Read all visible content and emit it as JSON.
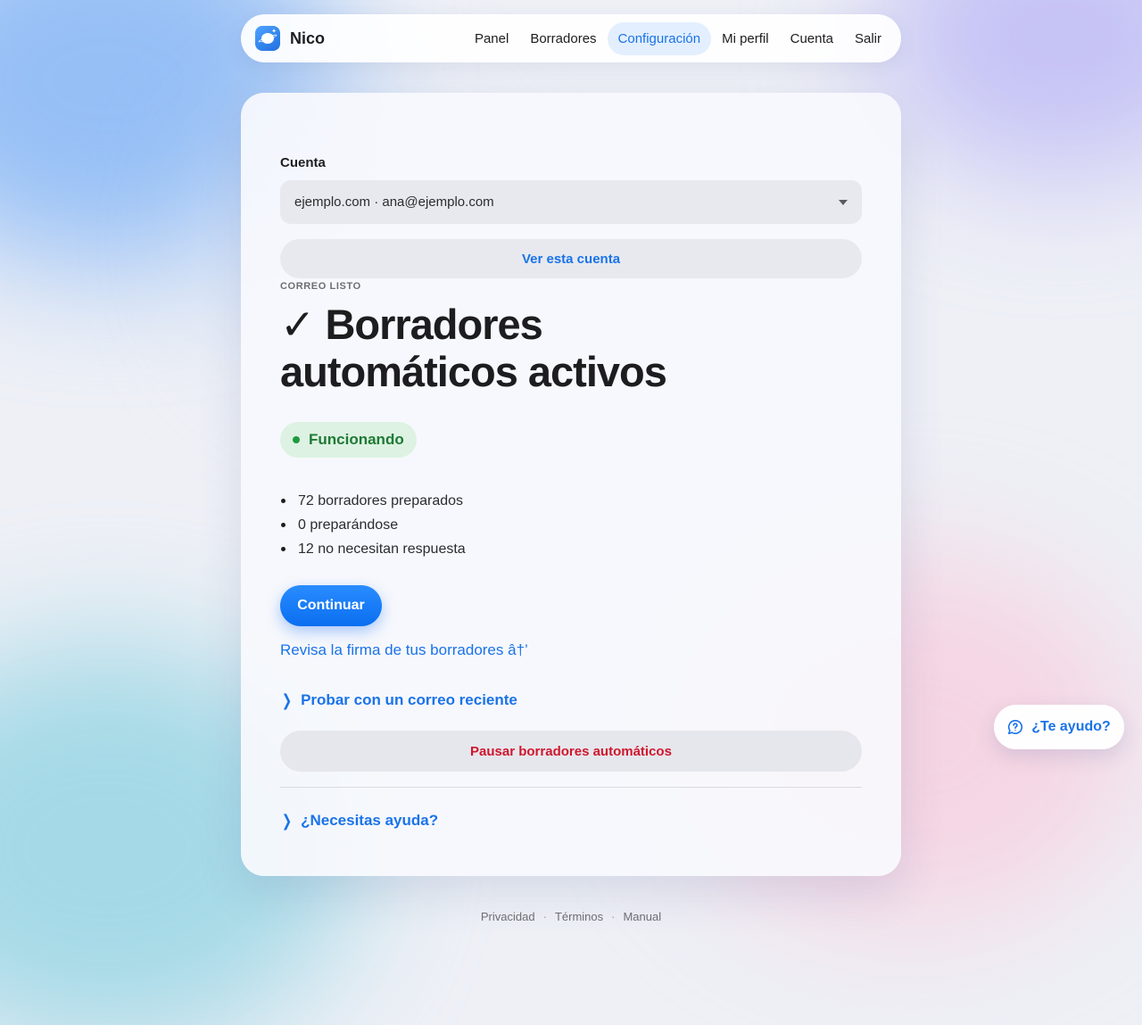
{
  "brand": {
    "name": "Nico",
    "logo_icon": "planet-icon"
  },
  "nav": {
    "items": [
      {
        "label": "Panel",
        "active": false
      },
      {
        "label": "Borradores",
        "active": false
      },
      {
        "label": "Configuración",
        "active": true
      },
      {
        "label": "Mi perfil",
        "active": false
      },
      {
        "label": "Cuenta",
        "active": false
      },
      {
        "label": "Salir",
        "active": false
      }
    ]
  },
  "account": {
    "label": "Cuenta",
    "selected": "ejemplo.com · ana@ejemplo.com",
    "view_button": "Ver esta cuenta"
  },
  "status": {
    "eyebrow": "CORREO LISTO",
    "title": "✓ Borradores automáticos activos",
    "badge": "Funcionando",
    "badge_color": "#1e7a34",
    "stats": [
      "72 borradores preparados",
      "0 preparándose",
      "12 no necesitan respuesta"
    ]
  },
  "actions": {
    "continue": "Continuar",
    "signature_link": "Revisa la firma de tus borradores â†’",
    "try_recent": "Probar con un correo reciente",
    "pause": "Pausar borradores automáticos",
    "need_help": "¿Necesitas ayuda?"
  },
  "footer": {
    "links": [
      "Privacidad",
      "Términos",
      "Manual"
    ],
    "separator": "·"
  },
  "help_fab": {
    "label": "¿Te ayudo?",
    "icon": "help-chat-icon"
  },
  "colors": {
    "accent": "#1a73e8",
    "danger": "#d0162e",
    "success": "#1e7a34"
  }
}
